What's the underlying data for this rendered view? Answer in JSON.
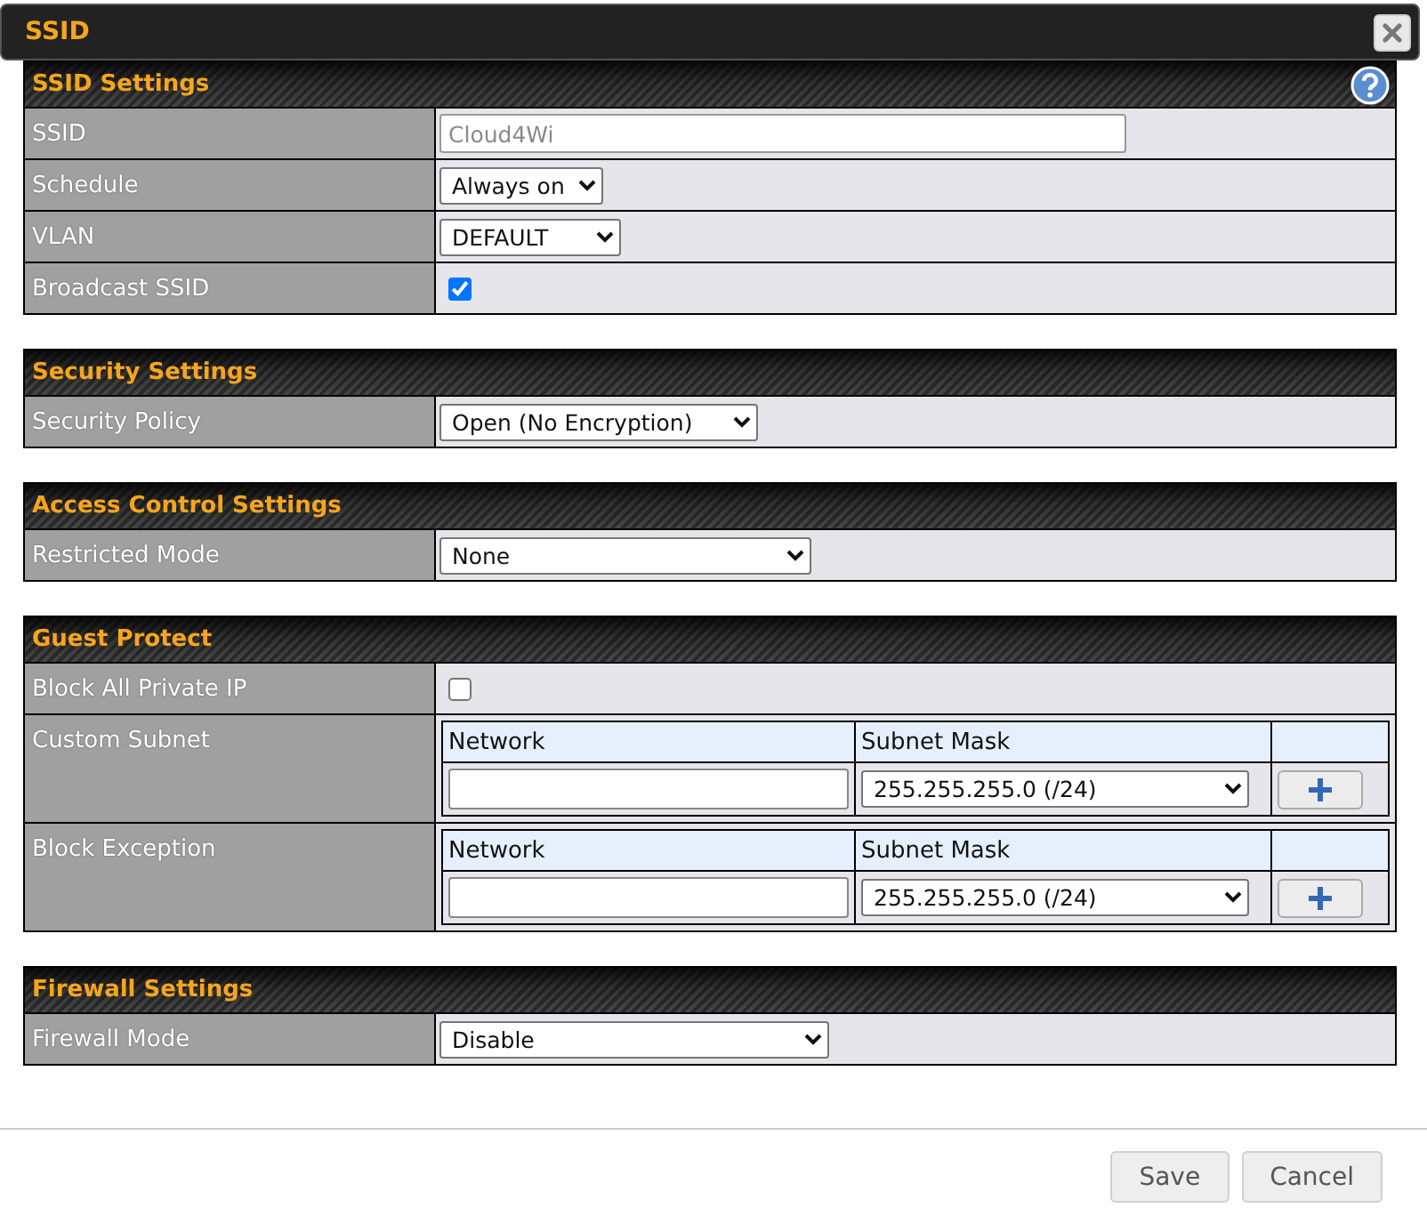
{
  "dialog": {
    "title": "SSID"
  },
  "sections": [
    {
      "title": "SSID Settings",
      "help": true,
      "rows": [
        {
          "kind": "text",
          "label": "SSID",
          "placeholder": "Cloud4Wi"
        },
        {
          "kind": "select",
          "label": "Schedule",
          "value": "Always on"
        },
        {
          "kind": "select",
          "label": "VLAN",
          "value": "DEFAULT"
        },
        {
          "kind": "checkbox",
          "label": "Broadcast SSID",
          "checked": true
        }
      ]
    },
    {
      "title": "Security Settings",
      "rows": [
        {
          "kind": "select",
          "label": "Security Policy",
          "value": "Open (No Encryption)"
        }
      ]
    },
    {
      "title": "Access Control Settings",
      "rows": [
        {
          "kind": "select",
          "label": "Restricted Mode",
          "value": "None"
        }
      ]
    },
    {
      "title": "Guest Protect",
      "rows": [
        {
          "kind": "checkbox",
          "label": "Block All Private IP",
          "checked": false
        },
        {
          "kind": "subnet",
          "label": "Custom Subnet",
          "columns": [
            "Network",
            "Subnet Mask"
          ],
          "mask": "255.255.255.0 (/24)"
        },
        {
          "kind": "subnet",
          "label": "Block Exception",
          "columns": [
            "Network",
            "Subnet Mask"
          ],
          "mask": "255.255.255.0 (/24)"
        }
      ]
    },
    {
      "title": "Firewall Settings",
      "rows": [
        {
          "kind": "select",
          "label": "Firewall Mode",
          "value": "Disable"
        }
      ]
    }
  ],
  "buttons": [
    "Save",
    "Cancel"
  ]
}
